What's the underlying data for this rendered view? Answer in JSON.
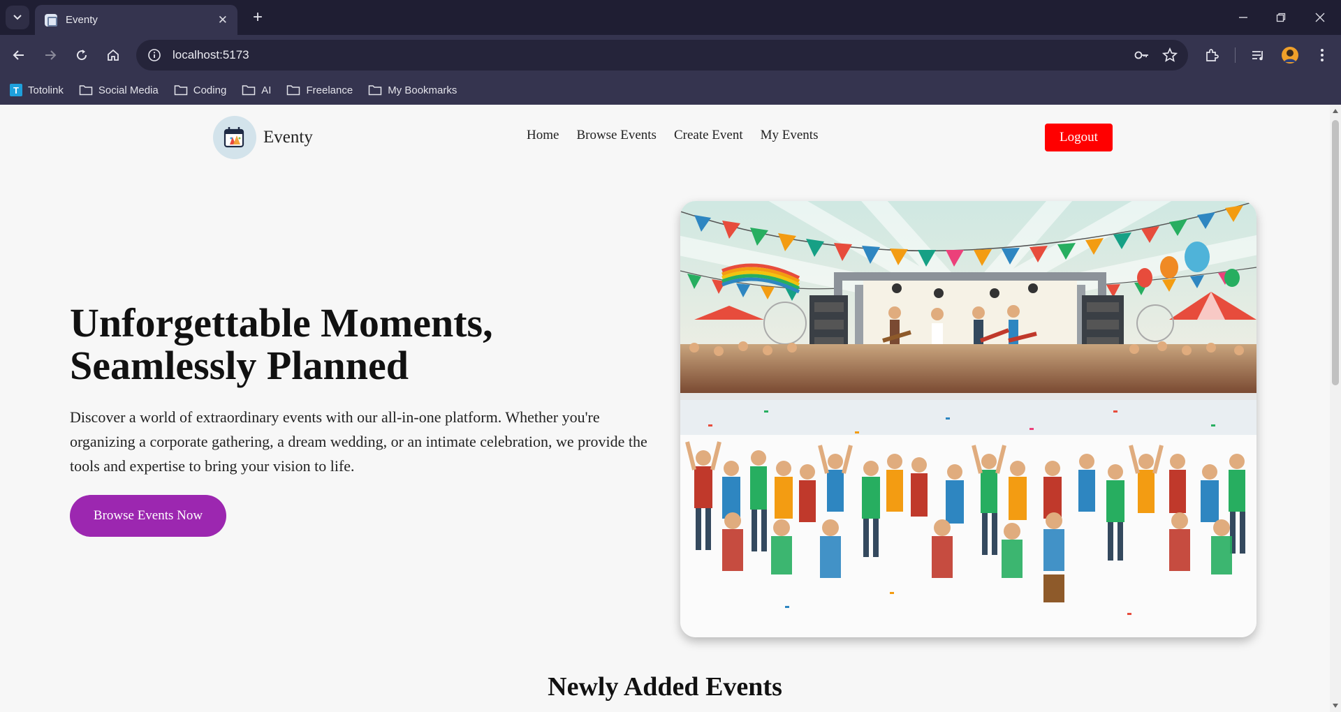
{
  "browser": {
    "tab_title": "Eventy",
    "url": "localhost:5173",
    "bookmarks": [
      {
        "label": "Totolink",
        "icon": "totolink-icon"
      },
      {
        "label": "Social Media",
        "icon": "folder-icon"
      },
      {
        "label": "Coding",
        "icon": "folder-icon"
      },
      {
        "label": "AI",
        "icon": "folder-icon"
      },
      {
        "label": "Freelance",
        "icon": "folder-icon"
      },
      {
        "label": "My Bookmarks",
        "icon": "folder-icon"
      }
    ]
  },
  "site": {
    "brand": "Eventy",
    "nav": [
      "Home",
      "Browse Events",
      "Create Event",
      "My Events"
    ],
    "logout_label": "Logout"
  },
  "hero": {
    "title_line1": "Unforgettable Moments,",
    "title_line2": "Seamlessly Planned",
    "description": "Discover a world of extraordinary events with our all-in-one platform. Whether you're organizing a corporate gathering, a dream wedding, or an intimate celebration, we provide the tools and expertise to bring your vision to life.",
    "cta_label": "Browse Events Now",
    "image": "festival-concert-crowd-illustration"
  },
  "sections": {
    "newly_added_title": "Newly Added Events"
  },
  "colors": {
    "logout": "#ff0000",
    "cta": "#9c27b0",
    "page_bg": "#f7f7f7",
    "chrome_dark": "#1f1e33",
    "chrome_toolbar": "#35344f"
  }
}
